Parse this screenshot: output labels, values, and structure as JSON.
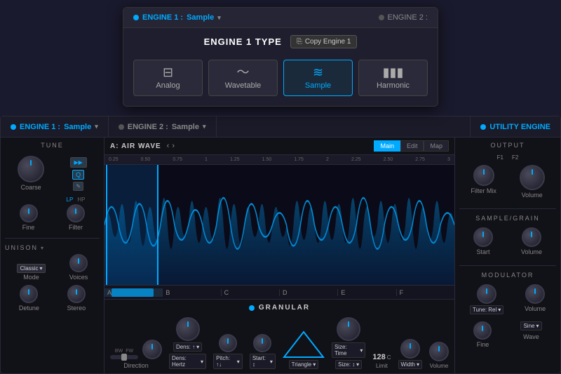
{
  "popup": {
    "engine1_label": "ENGINE 1 :",
    "engine1_type": "Sample",
    "engine2_label": "ENGINE 2 :",
    "type_title": "ENGINE 1 TYPE",
    "copy_label": "Copy Engine 1",
    "types": [
      {
        "id": "analog",
        "label": "Analog",
        "icon": "⊟"
      },
      {
        "id": "wavetable",
        "label": "Wavetable",
        "icon": "∿"
      },
      {
        "id": "sample",
        "label": "Sample",
        "icon": "≈≈"
      },
      {
        "id": "harmonic",
        "label": "Harmonic",
        "icon": "▮▮▮"
      }
    ],
    "active_type": "sample"
  },
  "main": {
    "engine1_label": "ENGINE 1 :",
    "engine1_type": "Sample",
    "engine2_label": "ENGINE 2 :",
    "engine2_type": "Sample",
    "utility_label": "UTILITY ENGINE",
    "tune_title": "TUNE",
    "coarse_label": "Coarse",
    "fine_label": "Fine",
    "filter_label": "Filter",
    "lp_label": "LP",
    "hp_label": "HP",
    "unison_title": "UNISON",
    "mode_label": "Mode",
    "voices_label": "Voices",
    "classic_label": "Classic",
    "detune_label": "Detune",
    "stereo_label": "Stereo",
    "wave_name": "A: AIR WAVE",
    "ruler_marks": [
      "0.25",
      "0.50",
      "0.75",
      "1",
      "1.25",
      "1.50",
      "1.75",
      "2",
      "2.25",
      "2.50",
      "2.75",
      "3"
    ],
    "view_tabs": [
      "Main",
      "Edit",
      "Map"
    ],
    "active_view": "Main",
    "segments": [
      "A",
      "B",
      "C",
      "D",
      "E",
      "F"
    ],
    "granular_title": "GRANULAR",
    "dens_label": "Dens: ↑",
    "dens_hertz_label": "Dens: Hertz",
    "size_time_label": "Size: Time",
    "size2_label": "Size: ↕",
    "pitch_label": "Pitch: ↑↓",
    "start_label": "Start: ↕",
    "triangle_label": "Triangle",
    "limit_label": "Limit",
    "limit_value": "128",
    "width_label": "Width",
    "volume_label": "Volume",
    "direction_label": "Direction",
    "bw_label": "BW",
    "fw_label": "FW",
    "output_title": "OUTPUT",
    "filter_mix_label": "Filter Mix",
    "output_volume_label": "Volume",
    "f1_label": "F1",
    "f2_label": "F2",
    "sample_grain_title": "SAMPLE/GRAIN",
    "start_grain_label": "Start",
    "vol_grain_label": "Volume",
    "modulator_title": "MODULATOR",
    "tune_rel_label": "Tune: Rel",
    "mod_vol_label": "Volume",
    "fine_mod_label": "Fine",
    "wave_label": "Wave",
    "sine_label": "Sine"
  }
}
